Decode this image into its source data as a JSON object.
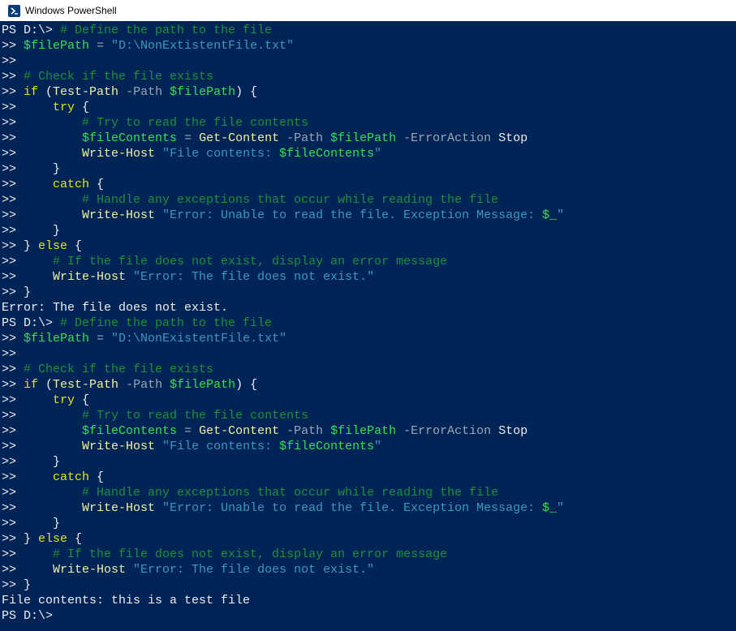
{
  "window": {
    "title": "Windows PowerShell",
    "colors": {
      "background": "#012456",
      "text": "#eeedf0",
      "comment": "#1f8f3a",
      "keyword": "#e5e510",
      "command": "#f2f2a0",
      "variable": "#36e04f",
      "string": "#3f98b8",
      "parameter": "#9aa6b2"
    }
  },
  "console": {
    "lines": [
      {
        "tokens": [
          {
            "t": "PS D:\\> ",
            "c": "prompt"
          },
          {
            "t": "# Define the path to the file",
            "c": "comment"
          }
        ]
      },
      {
        "tokens": [
          {
            "t": ">> ",
            "c": "prompt"
          },
          {
            "t": "$filePath",
            "c": "var"
          },
          {
            "t": " = ",
            "c": "op"
          },
          {
            "t": "\"D:\\NonExtistentFile.txt\"",
            "c": "str"
          }
        ]
      },
      {
        "tokens": [
          {
            "t": ">>",
            "c": "prompt"
          }
        ]
      },
      {
        "tokens": [
          {
            "t": ">> ",
            "c": "prompt"
          },
          {
            "t": "# Check if the file exists",
            "c": "comment"
          }
        ]
      },
      {
        "tokens": [
          {
            "t": ">> ",
            "c": "prompt"
          },
          {
            "t": "if",
            "c": "keyword"
          },
          {
            "t": " (",
            "c": "plain"
          },
          {
            "t": "Test-Path",
            "c": "cmd"
          },
          {
            "t": " -Path",
            "c": "param"
          },
          {
            "t": " ",
            "c": "plain"
          },
          {
            "t": "$filePath",
            "c": "var"
          },
          {
            "t": ") {",
            "c": "plain"
          }
        ]
      },
      {
        "tokens": [
          {
            "t": ">>     ",
            "c": "prompt"
          },
          {
            "t": "try",
            "c": "keyword"
          },
          {
            "t": " {",
            "c": "plain"
          }
        ]
      },
      {
        "tokens": [
          {
            "t": ">>         ",
            "c": "prompt"
          },
          {
            "t": "# Try to read the file contents",
            "c": "comment"
          }
        ]
      },
      {
        "tokens": [
          {
            "t": ">>         ",
            "c": "prompt"
          },
          {
            "t": "$fileContents",
            "c": "var"
          },
          {
            "t": " = ",
            "c": "op"
          },
          {
            "t": "Get-Content",
            "c": "cmd"
          },
          {
            "t": " -Path",
            "c": "param"
          },
          {
            "t": " ",
            "c": "plain"
          },
          {
            "t": "$filePath",
            "c": "var"
          },
          {
            "t": " -ErrorAction",
            "c": "param"
          },
          {
            "t": " Stop",
            "c": "plain"
          }
        ]
      },
      {
        "tokens": [
          {
            "t": ">>         ",
            "c": "prompt"
          },
          {
            "t": "Write-Host",
            "c": "cmd"
          },
          {
            "t": " ",
            "c": "plain"
          },
          {
            "t": "\"File contents: ",
            "c": "str"
          },
          {
            "t": "$fileContents",
            "c": "var"
          },
          {
            "t": "\"",
            "c": "str"
          }
        ]
      },
      {
        "tokens": [
          {
            "t": ">>     }",
            "c": "prompt"
          }
        ]
      },
      {
        "tokens": [
          {
            "t": ">>     ",
            "c": "prompt"
          },
          {
            "t": "catch",
            "c": "keyword"
          },
          {
            "t": " {",
            "c": "plain"
          }
        ]
      },
      {
        "tokens": [
          {
            "t": ">>         ",
            "c": "prompt"
          },
          {
            "t": "# Handle any exceptions that occur while reading the file",
            "c": "comment"
          }
        ]
      },
      {
        "tokens": [
          {
            "t": ">>         ",
            "c": "prompt"
          },
          {
            "t": "Write-Host",
            "c": "cmd"
          },
          {
            "t": " ",
            "c": "plain"
          },
          {
            "t": "\"Error: Unable to read the file. Exception Message: ",
            "c": "str"
          },
          {
            "t": "$_",
            "c": "var"
          },
          {
            "t": "\"",
            "c": "str"
          }
        ]
      },
      {
        "tokens": [
          {
            "t": ">>     }",
            "c": "prompt"
          }
        ]
      },
      {
        "tokens": [
          {
            "t": ">> } ",
            "c": "prompt"
          },
          {
            "t": "else",
            "c": "keyword"
          },
          {
            "t": " {",
            "c": "plain"
          }
        ]
      },
      {
        "tokens": [
          {
            "t": ">>     ",
            "c": "prompt"
          },
          {
            "t": "# If the file does not exist, display an error message",
            "c": "comment"
          }
        ]
      },
      {
        "tokens": [
          {
            "t": ">>     ",
            "c": "prompt"
          },
          {
            "t": "Write-Host",
            "c": "cmd"
          },
          {
            "t": " ",
            "c": "plain"
          },
          {
            "t": "\"Error: The file does not exist.\"",
            "c": "str"
          }
        ]
      },
      {
        "tokens": [
          {
            "t": ">> }",
            "c": "prompt"
          }
        ]
      },
      {
        "tokens": [
          {
            "t": "Error: The file does not exist.",
            "c": "out"
          }
        ]
      },
      {
        "tokens": [
          {
            "t": "PS D:\\> ",
            "c": "prompt"
          },
          {
            "t": "# Define the path to the file",
            "c": "comment"
          }
        ]
      },
      {
        "tokens": [
          {
            "t": ">> ",
            "c": "prompt"
          },
          {
            "t": "$filePath",
            "c": "var"
          },
          {
            "t": " = ",
            "c": "op"
          },
          {
            "t": "\"D:\\NonExistentFile.txt\"",
            "c": "str"
          }
        ]
      },
      {
        "tokens": [
          {
            "t": ">>",
            "c": "prompt"
          }
        ]
      },
      {
        "tokens": [
          {
            "t": ">> ",
            "c": "prompt"
          },
          {
            "t": "# Check if the file exists",
            "c": "comment"
          }
        ]
      },
      {
        "tokens": [
          {
            "t": ">> ",
            "c": "prompt"
          },
          {
            "t": "if",
            "c": "keyword"
          },
          {
            "t": " (",
            "c": "plain"
          },
          {
            "t": "Test-Path",
            "c": "cmd"
          },
          {
            "t": " -Path",
            "c": "param"
          },
          {
            "t": " ",
            "c": "plain"
          },
          {
            "t": "$filePath",
            "c": "var"
          },
          {
            "t": ") {",
            "c": "plain"
          }
        ]
      },
      {
        "tokens": [
          {
            "t": ">>     ",
            "c": "prompt"
          },
          {
            "t": "try",
            "c": "keyword"
          },
          {
            "t": " {",
            "c": "plain"
          }
        ]
      },
      {
        "tokens": [
          {
            "t": ">>         ",
            "c": "prompt"
          },
          {
            "t": "# Try to read the file contents",
            "c": "comment"
          }
        ]
      },
      {
        "tokens": [
          {
            "t": ">>         ",
            "c": "prompt"
          },
          {
            "t": "$fileContents",
            "c": "var"
          },
          {
            "t": " = ",
            "c": "op"
          },
          {
            "t": "Get-Content",
            "c": "cmd"
          },
          {
            "t": " -Path",
            "c": "param"
          },
          {
            "t": " ",
            "c": "plain"
          },
          {
            "t": "$filePath",
            "c": "var"
          },
          {
            "t": " -ErrorAction",
            "c": "param"
          },
          {
            "t": " Stop",
            "c": "plain"
          }
        ]
      },
      {
        "tokens": [
          {
            "t": ">>         ",
            "c": "prompt"
          },
          {
            "t": "Write-Host",
            "c": "cmd"
          },
          {
            "t": " ",
            "c": "plain"
          },
          {
            "t": "\"File contents: ",
            "c": "str"
          },
          {
            "t": "$fileContents",
            "c": "var"
          },
          {
            "t": "\"",
            "c": "str"
          }
        ]
      },
      {
        "tokens": [
          {
            "t": ">>     }",
            "c": "prompt"
          }
        ]
      },
      {
        "tokens": [
          {
            "t": ">>     ",
            "c": "prompt"
          },
          {
            "t": "catch",
            "c": "keyword"
          },
          {
            "t": " {",
            "c": "plain"
          }
        ]
      },
      {
        "tokens": [
          {
            "t": ">>         ",
            "c": "prompt"
          },
          {
            "t": "# Handle any exceptions that occur while reading the file",
            "c": "comment"
          }
        ]
      },
      {
        "tokens": [
          {
            "t": ">>         ",
            "c": "prompt"
          },
          {
            "t": "Write-Host",
            "c": "cmd"
          },
          {
            "t": " ",
            "c": "plain"
          },
          {
            "t": "\"Error: Unable to read the file. Exception Message: ",
            "c": "str"
          },
          {
            "t": "$_",
            "c": "var"
          },
          {
            "t": "\"",
            "c": "str"
          }
        ]
      },
      {
        "tokens": [
          {
            "t": ">>     }",
            "c": "prompt"
          }
        ]
      },
      {
        "tokens": [
          {
            "t": ">> } ",
            "c": "prompt"
          },
          {
            "t": "else",
            "c": "keyword"
          },
          {
            "t": " {",
            "c": "plain"
          }
        ]
      },
      {
        "tokens": [
          {
            "t": ">>     ",
            "c": "prompt"
          },
          {
            "t": "# If the file does not exist, display an error message",
            "c": "comment"
          }
        ]
      },
      {
        "tokens": [
          {
            "t": ">>     ",
            "c": "prompt"
          },
          {
            "t": "Write-Host",
            "c": "cmd"
          },
          {
            "t": " ",
            "c": "plain"
          },
          {
            "t": "\"Error: The file does not exist.\"",
            "c": "str"
          }
        ]
      },
      {
        "tokens": [
          {
            "t": ">> }",
            "c": "prompt"
          }
        ]
      },
      {
        "tokens": [
          {
            "t": "File contents: this is a test file",
            "c": "out"
          }
        ]
      },
      {
        "tokens": [
          {
            "t": "PS D:\\>",
            "c": "prompt"
          }
        ]
      }
    ]
  }
}
